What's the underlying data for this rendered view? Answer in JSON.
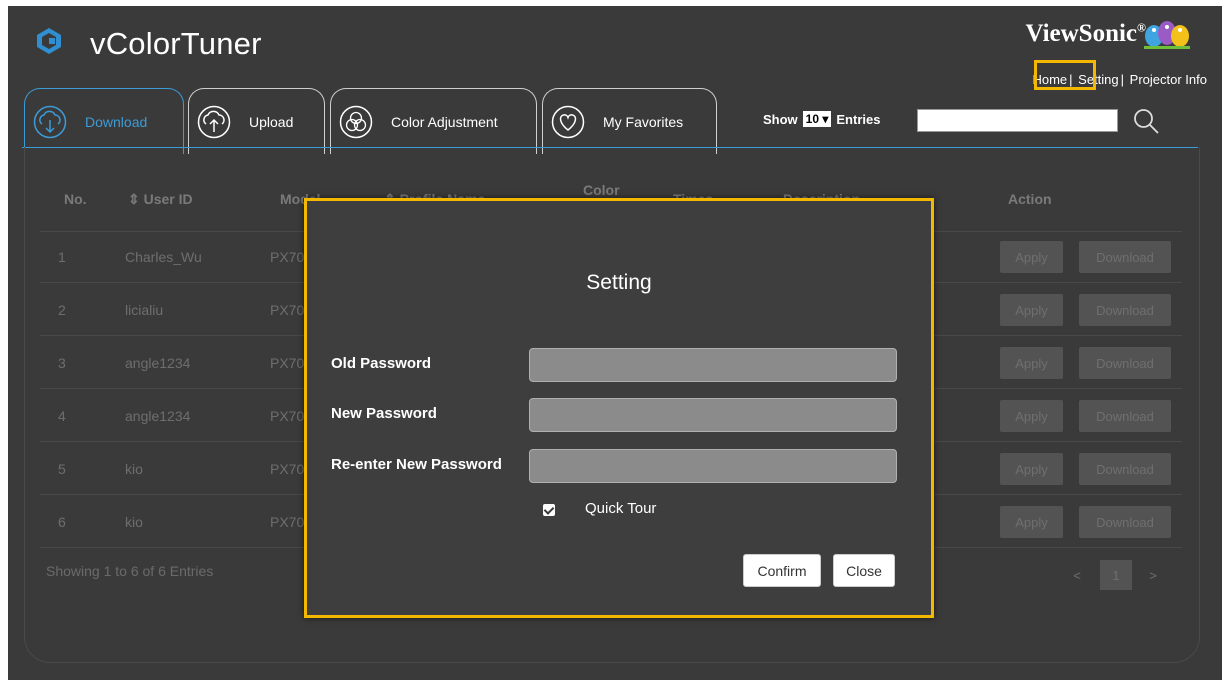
{
  "header": {
    "app_title": "vColorTuner",
    "brand": "ViewSonic",
    "brand_mark": "®",
    "links": {
      "home": "Home",
      "setting": "Setting",
      "projector_info": "Projector Info"
    }
  },
  "tabs": [
    {
      "label": "Download",
      "icon": "cloud-download-icon",
      "active": true
    },
    {
      "label": "Upload",
      "icon": "cloud-upload-icon",
      "active": false
    },
    {
      "label": "Color Adjustment",
      "icon": "color-circles-icon",
      "active": false
    },
    {
      "label": "My Favorites",
      "icon": "heart-icon",
      "active": false
    }
  ],
  "entries": {
    "show_label": "Show",
    "value": "10 ▾",
    "entries_label": "Entries"
  },
  "search": {
    "placeholder": "",
    "value": ""
  },
  "table": {
    "columns": [
      "No.",
      "⇕ User ID",
      "Model",
      "⇕ Profile Name",
      "Color",
      "Times",
      "Description",
      "Action"
    ],
    "rows": [
      {
        "no": "1",
        "user": "Charles_Wu",
        "model": "PX70"
      },
      {
        "no": "2",
        "user": "licialiu",
        "model": "PX70"
      },
      {
        "no": "3",
        "user": "angle1234",
        "model": "PX70"
      },
      {
        "no": "4",
        "user": "angle1234",
        "model": "PX70"
      },
      {
        "no": "5",
        "user": "kio",
        "model": "PX70"
      },
      {
        "no": "6",
        "user": "kio",
        "model": "PX70"
      }
    ],
    "apply_label": "Apply",
    "download_label": "Download",
    "footer": "Showing 1 to 6 of 6 Entries",
    "pager": {
      "prev": "<",
      "page": "1",
      "next": ">"
    }
  },
  "modal": {
    "title": "Setting",
    "fields": [
      {
        "label": "Old Password",
        "value": ""
      },
      {
        "label": "New Password",
        "value": ""
      },
      {
        "label": "Re-enter New Password",
        "value": ""
      }
    ],
    "quick_tour": {
      "label": "Quick Tour",
      "checked": true
    },
    "confirm_label": "Confirm",
    "close_label": "Close"
  },
  "colors": {
    "accent_blue": "#3d9bd6",
    "highlight_yellow": "#f5b800",
    "background": "#3a3a3a"
  }
}
